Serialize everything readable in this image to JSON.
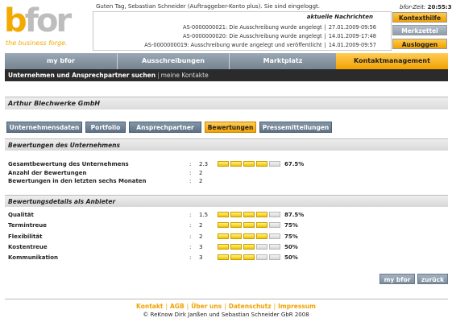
{
  "brand": {
    "logo_text_a": "b",
    "logo_text_b": "for",
    "tagline": "the business forge."
  },
  "header": {
    "greeting": "Guten Tag, Sebastian Schneider (Auftraggeber-Konto plus). Sie sind eingeloggt.",
    "time_label": "bfor-Zeit:",
    "time_value": "20:55:31"
  },
  "news": {
    "title": "aktuelle Nachrichten",
    "items": [
      {
        "text": "AS-0000000021: Die Ausschreibung wurde angelegt",
        "date": "27.01.2009-09:56"
      },
      {
        "text": "AS-0000000020: Die Ausschreibung wurde angelegt",
        "date": "14.01.2009-17:48"
      },
      {
        "text": "AS-0000000019: Ausschreibung wurde angelegt und veröffentlicht",
        "date": "14.01.2009-09:57"
      }
    ]
  },
  "side_buttons": {
    "help": "Kontexthilfe",
    "notes": "Merkzettel",
    "logout": "Ausloggen"
  },
  "main_nav": [
    {
      "label": "my bfor"
    },
    {
      "label": "Ausschreibungen"
    },
    {
      "label": "Marktplatz"
    },
    {
      "label": "Kontaktmanagement"
    }
  ],
  "sub_nav": {
    "active": "Unternehmen und Ansprechpartner suchen",
    "other": "meine Kontakte"
  },
  "company_name": "Arthur Blechwerke GmbH",
  "tabs": [
    {
      "label": "Unternehmensdaten"
    },
    {
      "label": "Portfolio"
    },
    {
      "label": "Ansprechpartner"
    },
    {
      "label": "Bewertungen"
    },
    {
      "label": "Pressemitteilungen"
    }
  ],
  "section_company": {
    "title": "Bewertungen des Unternehmens",
    "rows": [
      {
        "label": "Gesamtbewertung des Unternehmens",
        "value": "2.3",
        "percent_label": "67.5%",
        "fill": 4
      },
      {
        "label": "Anzahl der Bewertungen",
        "value": "2"
      },
      {
        "label": "Bewertungen in den letzten sechs Monaten",
        "value": "2"
      }
    ]
  },
  "section_details": {
    "title": "Bewertungsdetails als Anbieter",
    "rows": [
      {
        "label": "Qualität",
        "value": "1.5",
        "percent_label": "87.5%",
        "fill": 4
      },
      {
        "label": "Termintreue",
        "value": "2",
        "percent_label": "75%",
        "fill": 4
      },
      {
        "label": "Flexibilität",
        "value": "2",
        "percent_label": "75%",
        "fill": 4
      },
      {
        "label": "Kostentreue",
        "value": "3",
        "percent_label": "50%",
        "fill": 3
      },
      {
        "label": "Kommunikation",
        "value": "3",
        "percent_label": "50%",
        "fill": 3
      }
    ]
  },
  "action_buttons": {
    "my_bfor": "my bfor",
    "back": "zurück"
  },
  "footer": {
    "links": [
      "Kontakt",
      "AGB",
      "Über uns",
      "Datenschutz",
      "Impressum"
    ],
    "copyright": "© ReKnow Dirk Janßen und Sebastian Schneider GbR 2008"
  },
  "colors": {
    "accent": "#f2a200",
    "nav": "#75848f",
    "dark_bar": "#2b2b2b"
  }
}
